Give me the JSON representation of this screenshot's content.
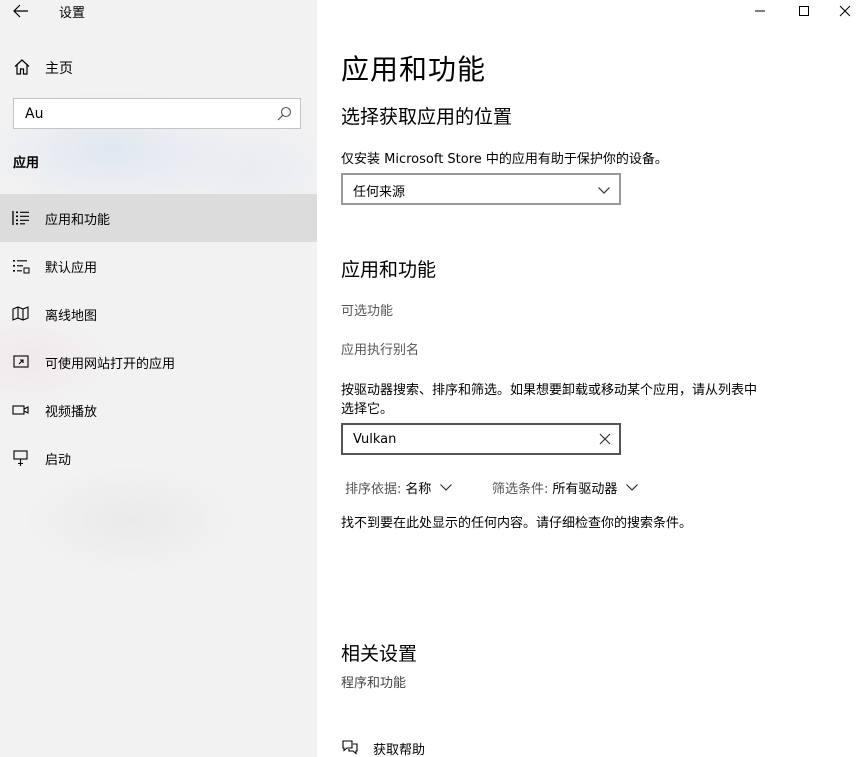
{
  "window": {
    "title": "设置"
  },
  "sidebar": {
    "home_label": "主页",
    "search": {
      "value": "Au"
    },
    "section_heading": "应用",
    "items": [
      {
        "label": "应用和功能",
        "icon": "apps-features-icon",
        "selected": true
      },
      {
        "label": "默认应用",
        "icon": "default-apps-icon",
        "selected": false
      },
      {
        "label": "离线地图",
        "icon": "offline-maps-icon",
        "selected": false
      },
      {
        "label": "可使用网站打开的应用",
        "icon": "apps-for-websites-icon",
        "selected": false
      },
      {
        "label": "视频播放",
        "icon": "video-playback-icon",
        "selected": false
      },
      {
        "label": "启动",
        "icon": "startup-icon",
        "selected": false
      }
    ]
  },
  "main": {
    "page_title": "应用和功能",
    "choose_location": {
      "heading": "选择获取应用的位置",
      "description": "仅安装 Microsoft Store 中的应用有助于保护你的设备。",
      "dropdown_value": "任何来源"
    },
    "apps_features": {
      "heading": "应用和功能",
      "optional_features_link": "可选功能",
      "app_alias_link": "应用执行别名",
      "description_line1": "按驱动器搜索、排序和筛选。如果想要卸载或移动某个应用，请从列表中",
      "description_line2": "选择它。",
      "search_value": "Vulkan",
      "sort_key": "排序依据:",
      "sort_value": "名称",
      "filter_key": "筛选条件:",
      "filter_value": "所有驱动器",
      "empty_message": "找不到要在此处显示的任何内容。请仔细检查你的搜索条件。"
    },
    "related": {
      "heading": "相关设置",
      "programs_link": "程序和功能"
    },
    "help": {
      "label": "获取帮助"
    }
  },
  "colors": {
    "accent": "#0078d7",
    "sidebar_bg": "#f2f2f2",
    "selected_bg": "#dcdcdc"
  }
}
